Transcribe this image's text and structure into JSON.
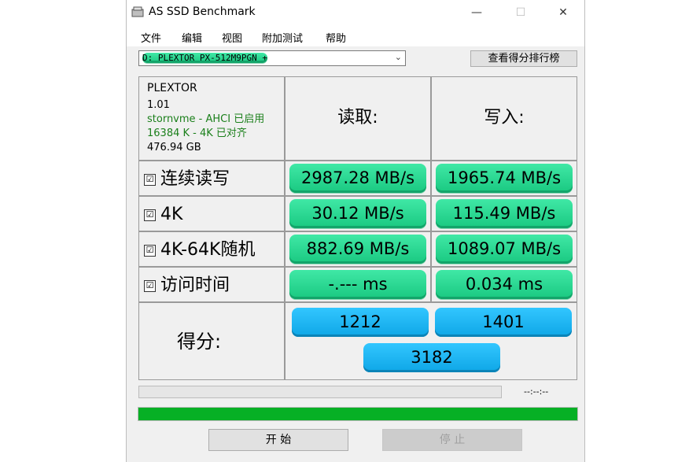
{
  "window": {
    "title": "AS SSD Benchmark",
    "minimize": "—",
    "maximize": "☐",
    "close": "✕"
  },
  "menu": [
    "文件",
    "编辑",
    "视图",
    "附加测试",
    "帮助"
  ],
  "drive_select": {
    "value": "D: PLEXTOR PX-512M9PGN +",
    "chevron": "⌄"
  },
  "rank_button": "查看得分排行榜",
  "info": {
    "vendor": "PLEXTOR",
    "firmware": "1.01",
    "driver": "stornvme - AHCI 已启用",
    "alignment": "16384 K - 4K 已对齐",
    "capacity": "476.94 GB"
  },
  "headers": {
    "read": "读取:",
    "write": "写入:"
  },
  "rows": [
    {
      "label": "连续读写",
      "checked": "☑",
      "read": "2987.28 MB/s",
      "write": "1965.74 MB/s"
    },
    {
      "label": "4K",
      "checked": "☑",
      "read": "30.12 MB/s",
      "write": "115.49 MB/s"
    },
    {
      "label": "4K-64K随机",
      "checked": "☑",
      "read": "882.69 MB/s",
      "write": "1089.07 MB/s"
    },
    {
      "label": "访问时间",
      "checked": "☑",
      "read": "-.--- ms",
      "write": "0.034 ms"
    }
  ],
  "score": {
    "label": "得分:",
    "read": "1212",
    "write": "1401",
    "total": "3182"
  },
  "timer": "--:--:--",
  "progress_complete": 1.0,
  "buttons": {
    "start": "开 始",
    "stop": "停 止"
  },
  "colors": {
    "value_green": "#19c880",
    "score_blue": "#0ea6e6",
    "progress_green": "#06b025",
    "info_green": "#1a7f1a"
  }
}
